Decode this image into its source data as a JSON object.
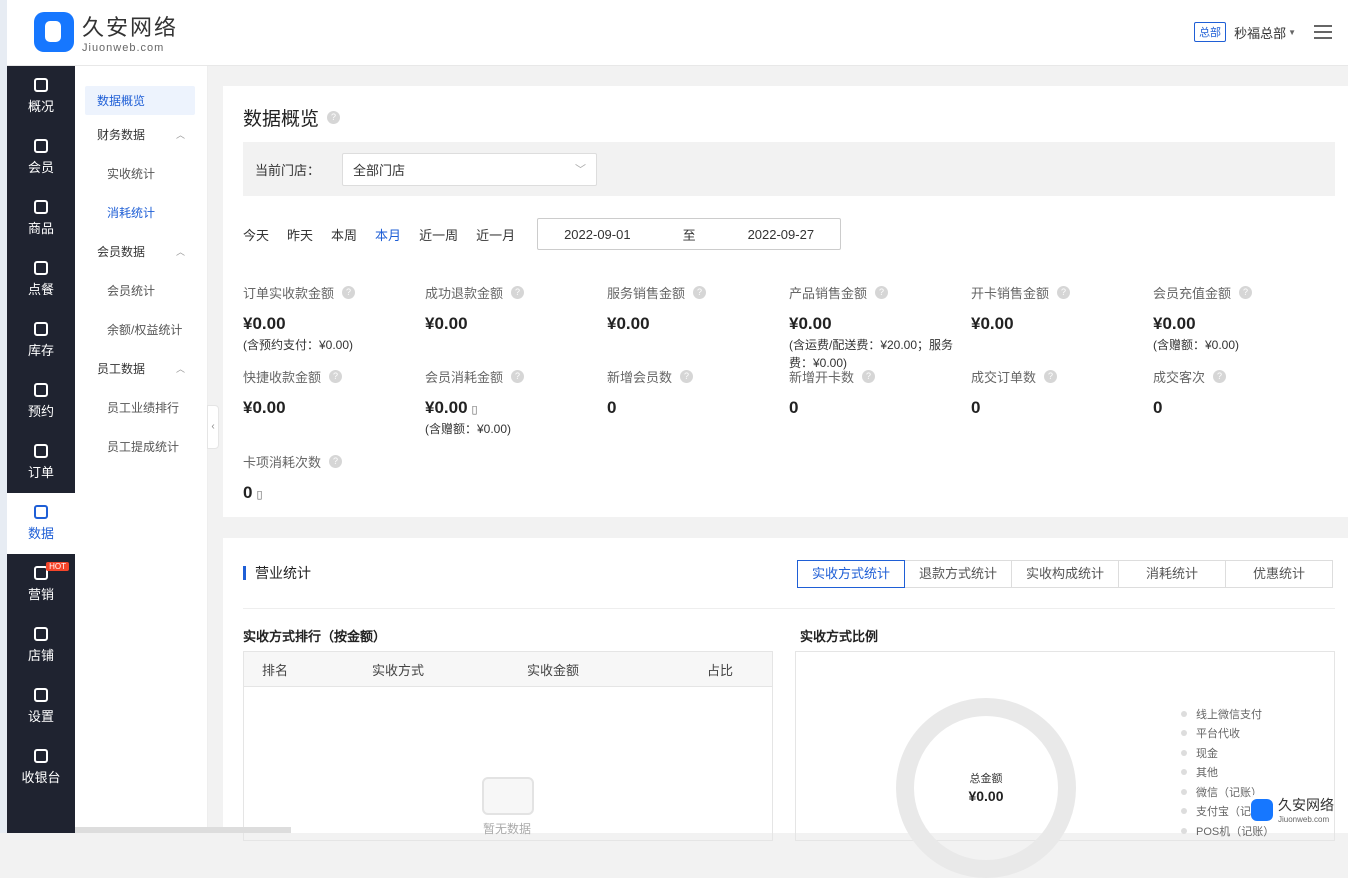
{
  "brand": {
    "name_cn": "久安网络",
    "name_en": "Jiuonweb.com"
  },
  "header": {
    "badge": "总部",
    "user": "秒福总部"
  },
  "nav": [
    {
      "label": "概况",
      "icon": "grid-icon"
    },
    {
      "label": "会员",
      "icon": "crown-icon"
    },
    {
      "label": "商品",
      "icon": "box-icon"
    },
    {
      "label": "点餐",
      "icon": "cloche-icon"
    },
    {
      "label": "库存",
      "icon": "inventory-icon"
    },
    {
      "label": "预约",
      "icon": "calendar-check-icon"
    },
    {
      "label": "订单",
      "icon": "clipboard-icon"
    },
    {
      "label": "数据",
      "icon": "chart-icon",
      "active": true
    },
    {
      "label": "营销",
      "icon": "marketing-icon",
      "hot": "HOT"
    },
    {
      "label": "店铺",
      "icon": "shop-icon"
    },
    {
      "label": "设置",
      "icon": "settings-icon"
    },
    {
      "label": "收银台",
      "icon": "cashier-icon"
    }
  ],
  "subnav": {
    "overview": "数据概览",
    "finance": {
      "label": "财务数据",
      "items": [
        "实收统计",
        "消耗统计"
      ]
    },
    "member": {
      "label": "会员数据",
      "items": [
        "会员统计",
        "余额/权益统计"
      ]
    },
    "staff": {
      "label": "员工数据",
      "items": [
        "员工业绩排行",
        "员工提成统计"
      ]
    }
  },
  "page": {
    "title": "数据概览",
    "store_label": "当前门店：",
    "store_value": "全部门店"
  },
  "periods": [
    "今天",
    "昨天",
    "本周",
    "本月",
    "近一周",
    "近一月"
  ],
  "date_range": {
    "start": "2022-09-01",
    "sep": "至",
    "end": "2022-09-27"
  },
  "stats": [
    {
      "label": "订单实收款金额",
      "value": "¥0.00",
      "note": "(含预约支付：¥0.00)"
    },
    {
      "label": "成功退款金额",
      "value": "¥0.00",
      "note": ""
    },
    {
      "label": "服务销售金额",
      "value": "¥0.00",
      "note": ""
    },
    {
      "label": "产品销售金额",
      "value": "¥0.00",
      "note": "(含运费/配送费：¥20.00；服务费：¥0.00)"
    },
    {
      "label": "开卡销售金额",
      "value": "¥0.00",
      "note": ""
    },
    {
      "label": "会员充值金额",
      "value": "¥0.00",
      "note": "(含赠额：¥0.00)"
    },
    {
      "label": "快捷收款金额",
      "value": "¥0.00",
      "note": ""
    },
    {
      "label": "会员消耗金额",
      "value": "¥0.00",
      "note": "(含赠额：¥0.00)"
    },
    {
      "label": "新增会员数",
      "value": "0",
      "note": ""
    },
    {
      "label": "新增开卡数",
      "value": "0",
      "note": ""
    },
    {
      "label": "成交订单数",
      "value": "0",
      "note": ""
    },
    {
      "label": "成交客次",
      "value": "0",
      "note": ""
    },
    {
      "label": "卡项消耗次数",
      "value": "0",
      "note": ""
    }
  ],
  "business": {
    "title": "营业统计",
    "tabs": [
      "实收方式统计",
      "退款方式统计",
      "实收构成统计",
      "消耗统计",
      "优惠统计"
    ],
    "rank_title": "实收方式排行（按金额）",
    "columns": [
      "排名",
      "实收方式",
      "实收金额",
      "占比"
    ],
    "empty": "暂无数据",
    "ratio_title": "实收方式比例",
    "total_label": "总金额",
    "total_value": "¥0.00",
    "legend": [
      "线上微信支付",
      "平台代收",
      "现金",
      "其他",
      "微信（记账）",
      "支付宝（记账）",
      "POS机（记账）"
    ]
  }
}
